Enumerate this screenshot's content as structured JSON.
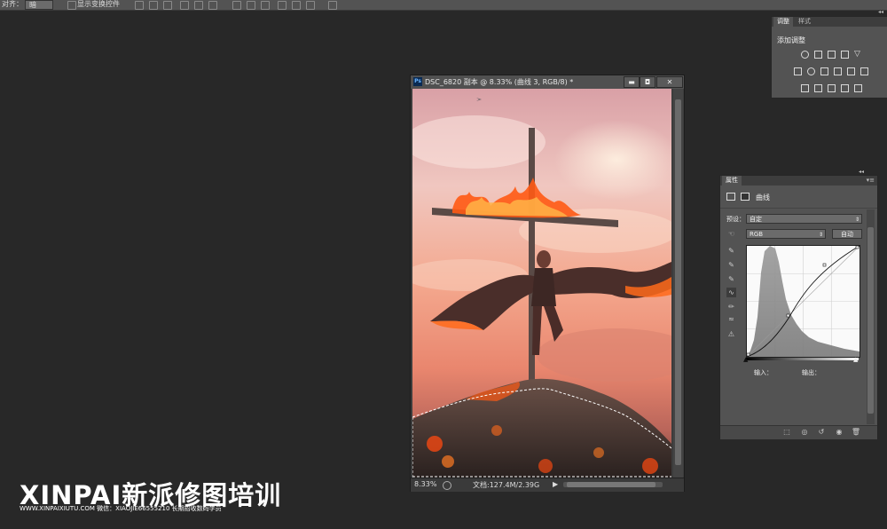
{
  "options_bar": {
    "left_label": "对齐：",
    "align_value": "暗",
    "checkbox_label": "显示变换控件"
  },
  "document": {
    "ps_badge": "Ps",
    "title": "DSC_6820 副本 @ 8.33% (曲线 3, RGB/8) *",
    "minimize": "▬",
    "maximize": "◘",
    "close": "✕",
    "zoom": "8.33%",
    "doc_info": "文档:127.4M/2.39G",
    "arrow": "▶"
  },
  "adjustments": {
    "tab_adjust": "调整",
    "tab_styles": "样式",
    "heading": "添加调整"
  },
  "properties": {
    "tab_label": "属性",
    "panel_title": "曲线",
    "preset_label": "预设：",
    "preset_value": "自定",
    "channel_value": "RGB",
    "auto_button": "自动",
    "input_label": "输入：",
    "output_label": "输出：",
    "icons": [
      "curves-adjust-icon",
      "mask-icon",
      "hand-target-icon",
      "eyedropper-black-icon",
      "eyedropper-gray-icon",
      "eyedropper-white-icon",
      "curve-tool-icon",
      "pencil-icon",
      "smooth-icon",
      "clipping-warning-icon",
      "clip-to-layer-icon",
      "view-previous-icon",
      "reset-icon",
      "visibility-icon",
      "delete-icon"
    ]
  },
  "watermark": {
    "title": "XINPAI新派修图培训",
    "subtitle": "WWW.XINPAIXIUTU.COM   微信：XIAOJIE66555210 长期招收数码学员"
  },
  "colors": {
    "workspace": "#282828",
    "panel": "#535353",
    "sky_top": "#e9a6a4",
    "fire": "#ff6a1a",
    "rock": "#3e3431"
  }
}
